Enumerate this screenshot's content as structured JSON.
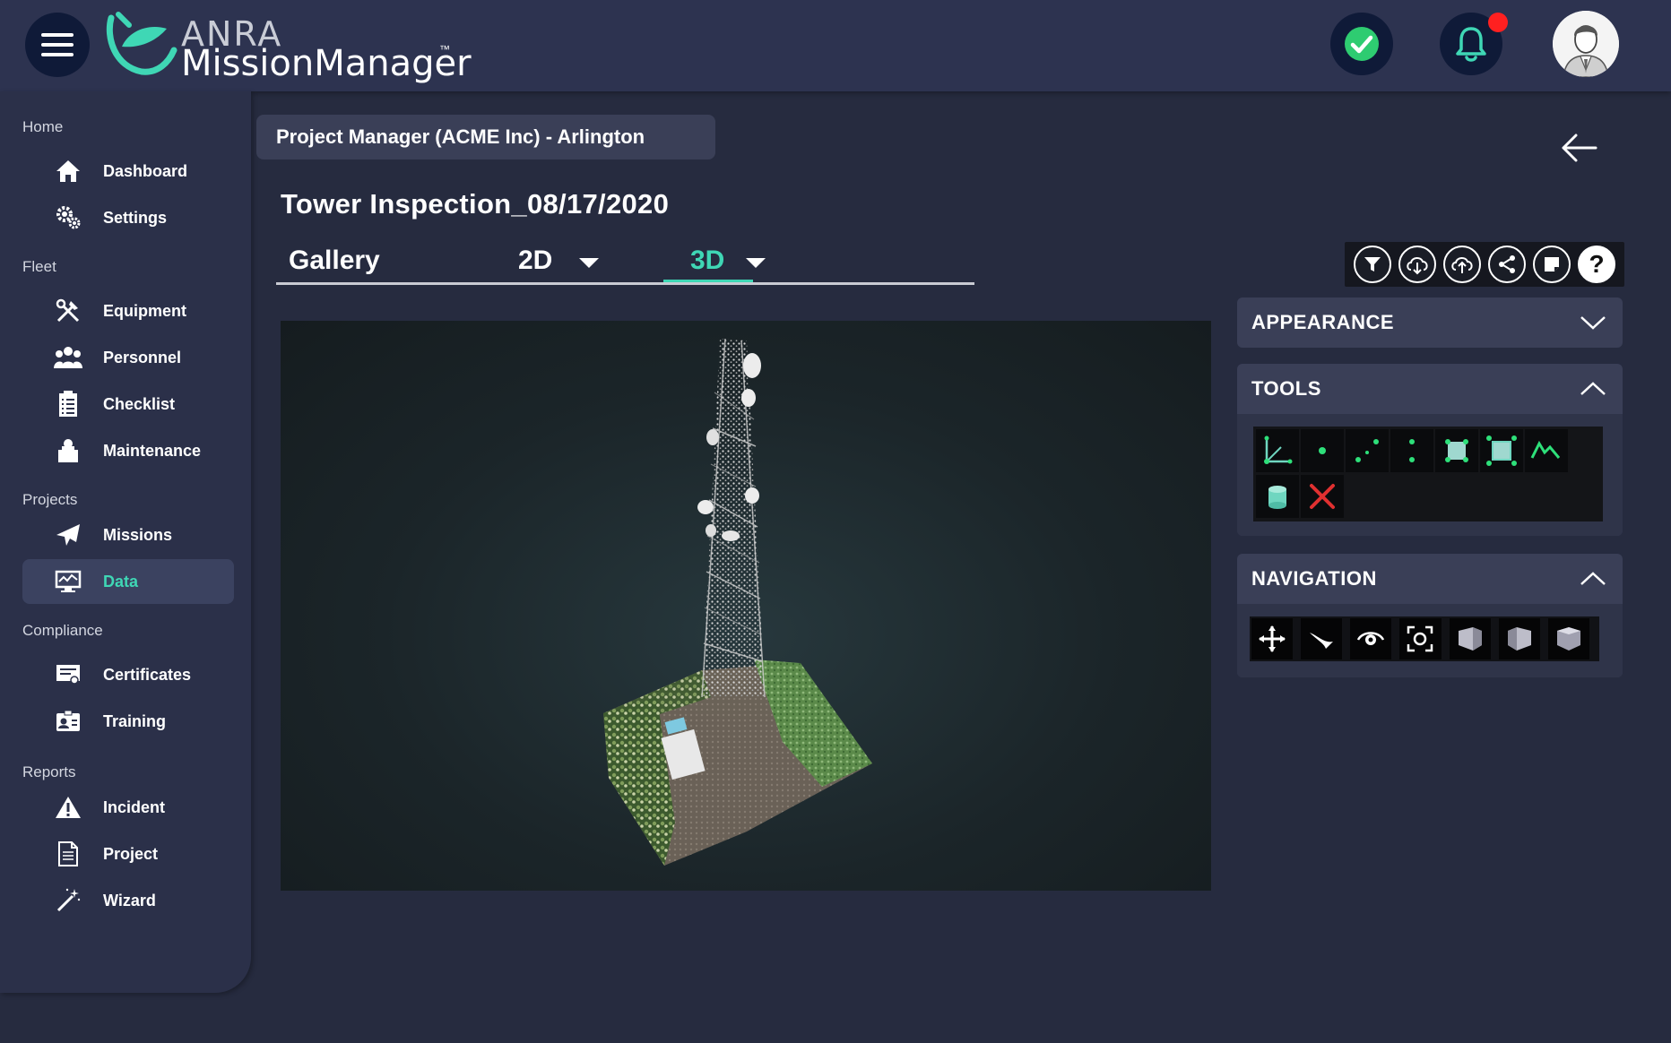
{
  "header": {
    "logo_top": "ANRA",
    "logo_main": "MissionManager",
    "logo_tm": "™"
  },
  "sidebar": {
    "sections": {
      "home": "Home",
      "fleet": "Fleet",
      "projects": "Projects",
      "compliance": "Compliance",
      "reports": "Reports"
    },
    "items": {
      "dashboard": "Dashboard",
      "settings": "Settings",
      "equipment": "Equipment",
      "personnel": "Personnel",
      "checklist": "Checklist",
      "maintenance": "Maintenance",
      "missions": "Missions",
      "data": "Data",
      "certificates": "Certificates",
      "training": "Training",
      "incident": "Incident",
      "project": "Project",
      "wizard": "Wizard"
    },
    "active_item": "Data"
  },
  "breadcrumb": "Project Manager (ACME Inc) - Arlington",
  "page_title": "Tower Inspection_08/17/2020",
  "tabs": {
    "gallery": "Gallery",
    "two_d": "2D",
    "three_d": "3D",
    "active": "3D"
  },
  "toolbar": {
    "icons": [
      "filter-icon",
      "cloud-download-icon",
      "cloud-upload-icon",
      "share-icon",
      "note-icon",
      "help-icon"
    ],
    "help_label": "?"
  },
  "panels": {
    "appearance": "APPEARANCE",
    "tools": "TOOLS",
    "navigation": "NAVIGATION"
  },
  "tools_icons": [
    "angle-measure-icon",
    "point-icon",
    "distance-icon",
    "height-icon",
    "area-icon",
    "volume-icon",
    "profile-icon",
    "cylinder-icon",
    "remove-measurements-icon"
  ],
  "navigation_icons": [
    "earth-controls-icon",
    "fly-controls-icon",
    "orbit-controls-icon",
    "full-extent-icon",
    "front-view-icon",
    "left-view-icon",
    "top-view-icon"
  ],
  "colors": {
    "accent": "#3fd7b5",
    "background": "#262b3f",
    "header": "#2d3350",
    "sidebar": "#2b3049",
    "status_ok": "#2ecc71",
    "notification_badge": "#ff2020"
  }
}
